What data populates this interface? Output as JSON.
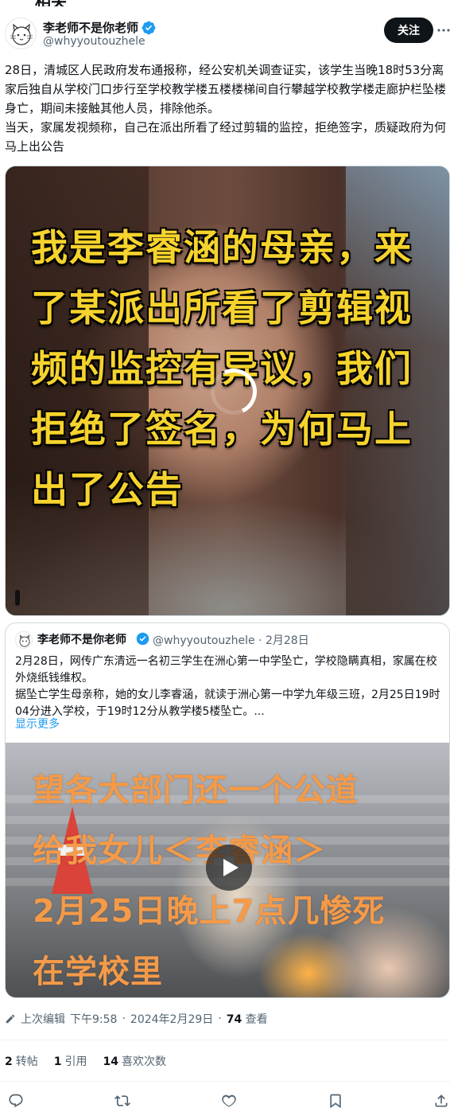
{
  "header": {
    "display_name": "李老师不是你老师",
    "handle": "@whyyoutouzhele",
    "follow_label": "关注",
    "more_label": "···"
  },
  "post": {
    "text": "28日，清城区人民政府发布通报称，经公安机关调查证实，该学生当晚18时53分离家后独自从学校门口步行至学校教学楼五楼楼梯间自行攀越学校教学楼走廊护栏坠楼身亡，期间未接触其他人员，排除他杀。\n当天，家属发视频称，自己在派出所看了经过剪辑的监控，拒绝签字，质疑政府为何马上出公告",
    "video_overlay": "我是李睿涵的母亲，来了某派出所看了剪辑视频的监控有异议，我们拒绝了签名，为何马上出了公告"
  },
  "quote": {
    "display_name": "李老师不是你老师",
    "handle": "@whyyoutouzhele",
    "separator": "·",
    "date": "2月28日",
    "text": "2月28日，网传广东清远一名初三学生在洲心第一中学坠亡，学校隐瞒真相，家属在校外烧纸钱维权。\n据坠亡学生母亲称，她的女儿李睿涵，就读于洲心第一中学九年级三班，2月25日19时04分进入学校，于19时12分从教学楼5楼坠亡。...",
    "show_more": "显示更多",
    "video_overlay": "望各大部门还一个公道\n给我女儿＜李睿涵＞\n2月25日晚上7点几惨死\n在学校里"
  },
  "meta": {
    "edited_label": "上次编辑",
    "time": "下午9:58",
    "date": "2024年2月29日",
    "views_count": "74",
    "views_label": "查看"
  },
  "stats": {
    "reposts_count": "2",
    "reposts_label": "转帖",
    "quotes_count": "1",
    "quotes_label": "引用",
    "likes_count": "14",
    "likes_label": "喜欢次数"
  },
  "actions": [
    "reply-icon",
    "repost-icon",
    "like-icon",
    "bookmark-icon",
    "share-icon"
  ],
  "colors": {
    "follow_bg": "#0f1419",
    "link": "#1d9bf0",
    "secondary_text": "#536471",
    "video_caption_yellow": "#f6d32d",
    "video_caption_orange": "#f59a48"
  }
}
